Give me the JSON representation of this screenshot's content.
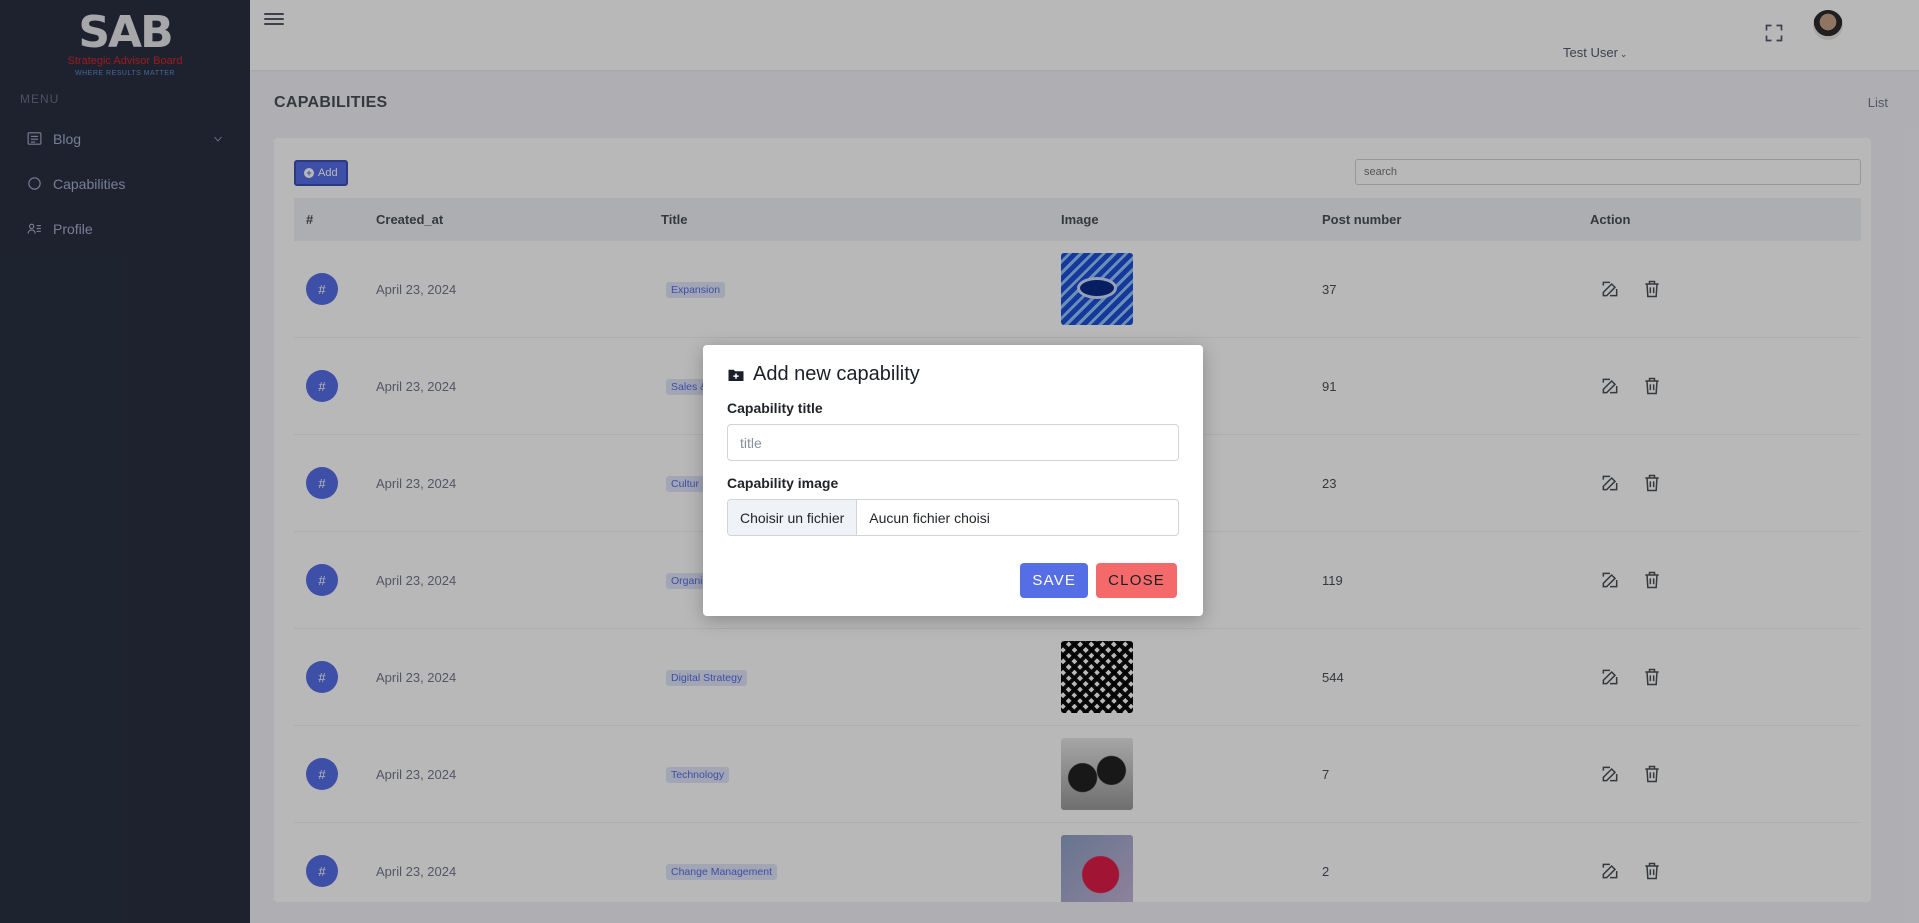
{
  "brand": {
    "logo_text": "SAB",
    "logo_subtitle": "Strategic Advisor Board",
    "logo_tagline": "WHERE RESULTS MATTER"
  },
  "sidebar": {
    "menu_title": "MENU",
    "items": [
      {
        "label": "Blog",
        "icon": "blog-icon",
        "has_submenu": true
      },
      {
        "label": "Capabilities",
        "icon": "circle-icon"
      },
      {
        "label": "Profile",
        "icon": "profile-icon"
      }
    ]
  },
  "topbar": {
    "user_name": "Test User"
  },
  "page": {
    "title": "CAPABILITIES",
    "breadcrumb": "List"
  },
  "toolbar": {
    "add_label": "Add",
    "search_placeholder": "search"
  },
  "table": {
    "columns": [
      "#",
      "Created_at",
      "Title",
      "Image",
      "Post number",
      "Action"
    ],
    "rows": [
      {
        "num": "#",
        "created_at": "April 23, 2024",
        "title": "Expansion",
        "post_number": "37"
      },
      {
        "num": "#",
        "created_at": "April 23, 2024",
        "title": "Sales &",
        "post_number": "91"
      },
      {
        "num": "#",
        "created_at": "April 23, 2024",
        "title": "Cultur",
        "post_number": "23"
      },
      {
        "num": "#",
        "created_at": "April 23, 2024",
        "title": "Organi",
        "post_number": "119"
      },
      {
        "num": "#",
        "created_at": "April 23, 2024",
        "title": "Digital Strategy",
        "post_number": "544"
      },
      {
        "num": "#",
        "created_at": "April 23, 2024",
        "title": "Technology",
        "post_number": "7"
      },
      {
        "num": "#",
        "created_at": "April 23, 2024",
        "title": "Change Management",
        "post_number": "2"
      }
    ]
  },
  "modal": {
    "title": "Add new capability",
    "title_label": "Capability title",
    "title_placeholder": "title",
    "image_label": "Capability image",
    "file_button": "Choisir un fichier",
    "file_status": "Aucun fichier choisi",
    "save_label": "SAVE",
    "close_label": "CLOSE"
  },
  "colors": {
    "primary": "#556ee6",
    "danger": "#f46a6a",
    "sidebar_bg": "#2a3042",
    "brand_red": "#d6262b"
  }
}
